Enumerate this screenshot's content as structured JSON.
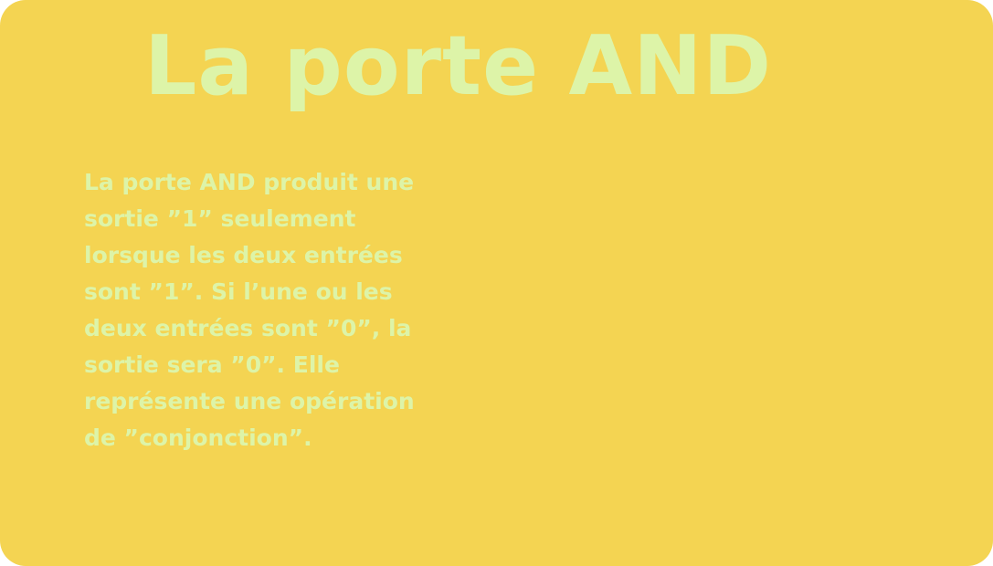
{
  "colors": {
    "card_background": "#F4D452",
    "text": "#DDF4A8"
  },
  "slide": {
    "title": "La porte AND",
    "paragraph_lines": [
      "La porte AND produit une",
      "sortie ”1” seulement",
      "lorsque les deux entrées",
      "sont ”1”. Si l’une ou les",
      "deux entrées sont ”0”, la",
      "sortie sera ”0”. Elle",
      "représente une opération",
      "de ”conjonction”."
    ]
  }
}
